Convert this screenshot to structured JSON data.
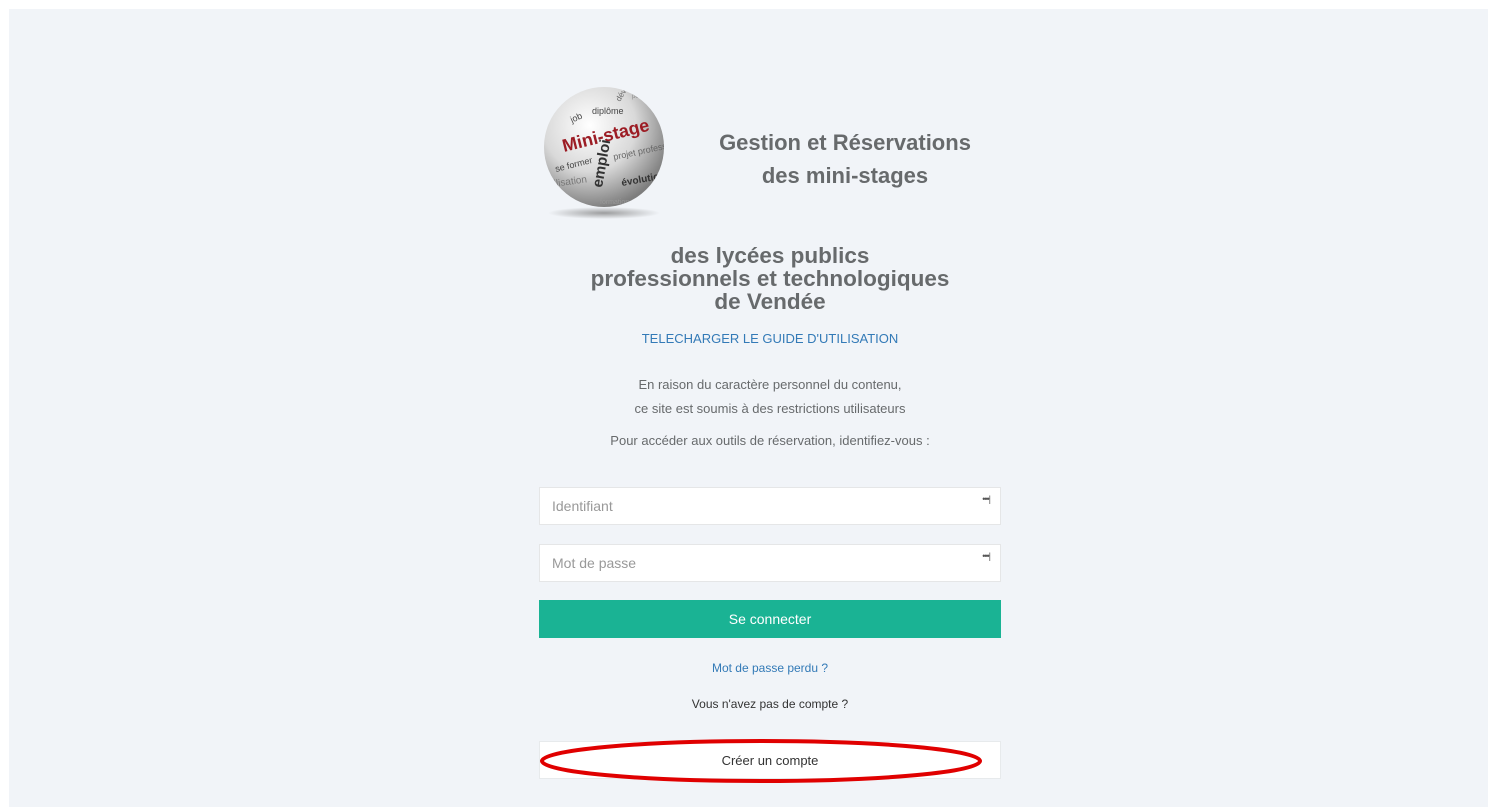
{
  "header": {
    "logo_words": [
      "Mini-stage",
      "emploi",
      "évolution",
      "projet professi",
      "se former",
      "diplôme",
      "job",
      "développ",
      "perfection",
      "formation",
      "utilisation"
    ],
    "title_line1": "Gestion et Réservations",
    "title_line2": "des mini-stages"
  },
  "subtitle": {
    "line1": "des lycées publics",
    "line2": "professionnels et technologiques",
    "line3": "de Vendée"
  },
  "guide_link": "TELECHARGER LE GUIDE D'UTILISATION",
  "info": {
    "line1": "En raison du caractère personnel du contenu,",
    "line2": "ce site est soumis à des restrictions utilisateurs"
  },
  "prompt": "Pour accéder aux outils de réservation, identifiez-vous :",
  "form": {
    "username_placeholder": "Identifiant",
    "password_placeholder": "Mot de passe",
    "field_icon": "•••|",
    "login_label": "Se connecter"
  },
  "lost_password": "Mot de passe perdu ?",
  "no_account": "Vous n'avez pas de compte ?",
  "create_account": "Créer un compte",
  "colors": {
    "background": "#f1f4f8",
    "primary": "#1ab394",
    "link": "#337ab7",
    "highlight": "#e00000"
  }
}
